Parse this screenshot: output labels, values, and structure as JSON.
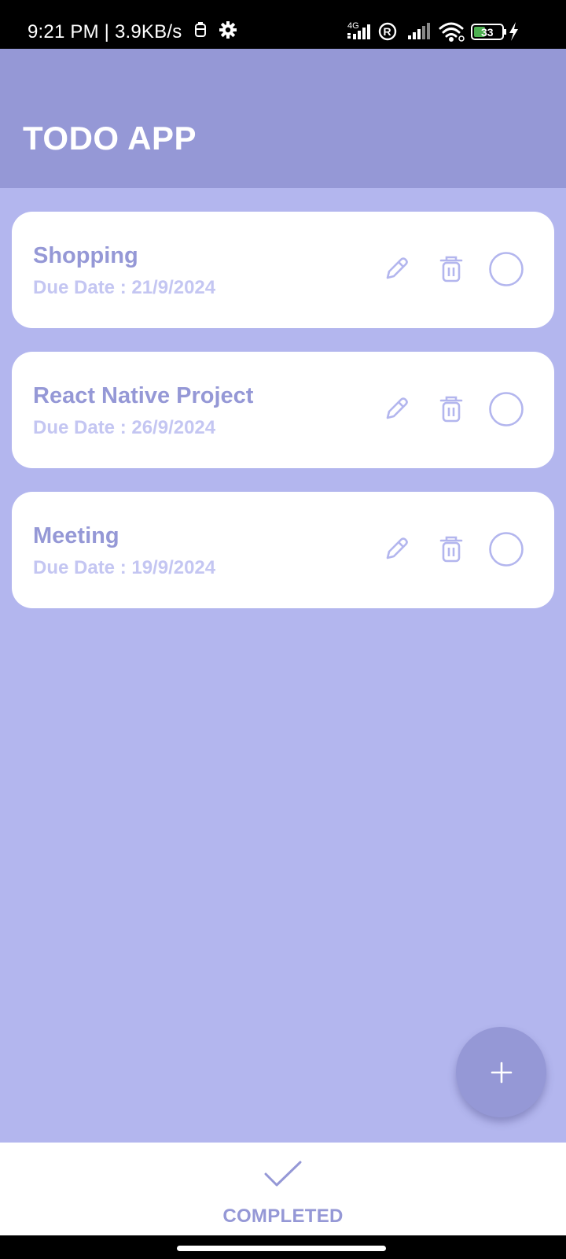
{
  "status_bar": {
    "time": "9:21 PM",
    "separator": " | ",
    "net_speed": "3.9KB/s",
    "battery_level": "33",
    "network_label": "4G",
    "icons": [
      "sim-icon",
      "gear-icon",
      "signal-4g-icon",
      "registered-icon",
      "signal-icon",
      "wifi-icon",
      "battery-icon",
      "charging-icon"
    ]
  },
  "header": {
    "title": "TODO APP"
  },
  "todos": [
    {
      "title": "Shopping",
      "due": "Due Date : 21/9/2024"
    },
    {
      "title": "React Native Project",
      "due": "Due Date : 26/9/2024"
    },
    {
      "title": "Meeting",
      "due": "Due Date : 19/9/2024"
    }
  ],
  "actions": {
    "edit_icon": "pencil-icon",
    "delete_icon": "trash-icon",
    "complete_icon": "circle-icon"
  },
  "fab": {
    "icon": "plus-icon"
  },
  "bottom_bar": {
    "completed_label": "COMPLETED",
    "completed_icon": "checkmark-icon"
  },
  "colors": {
    "header_bg": "#9598d6",
    "page_bg": "#b3b6ee",
    "title_text": "#9598d6",
    "due_text": "#c4c6f2",
    "icon_stroke": "#b3b6ee",
    "card_bg": "#ffffff",
    "battery_fill": "#4caf50"
  }
}
